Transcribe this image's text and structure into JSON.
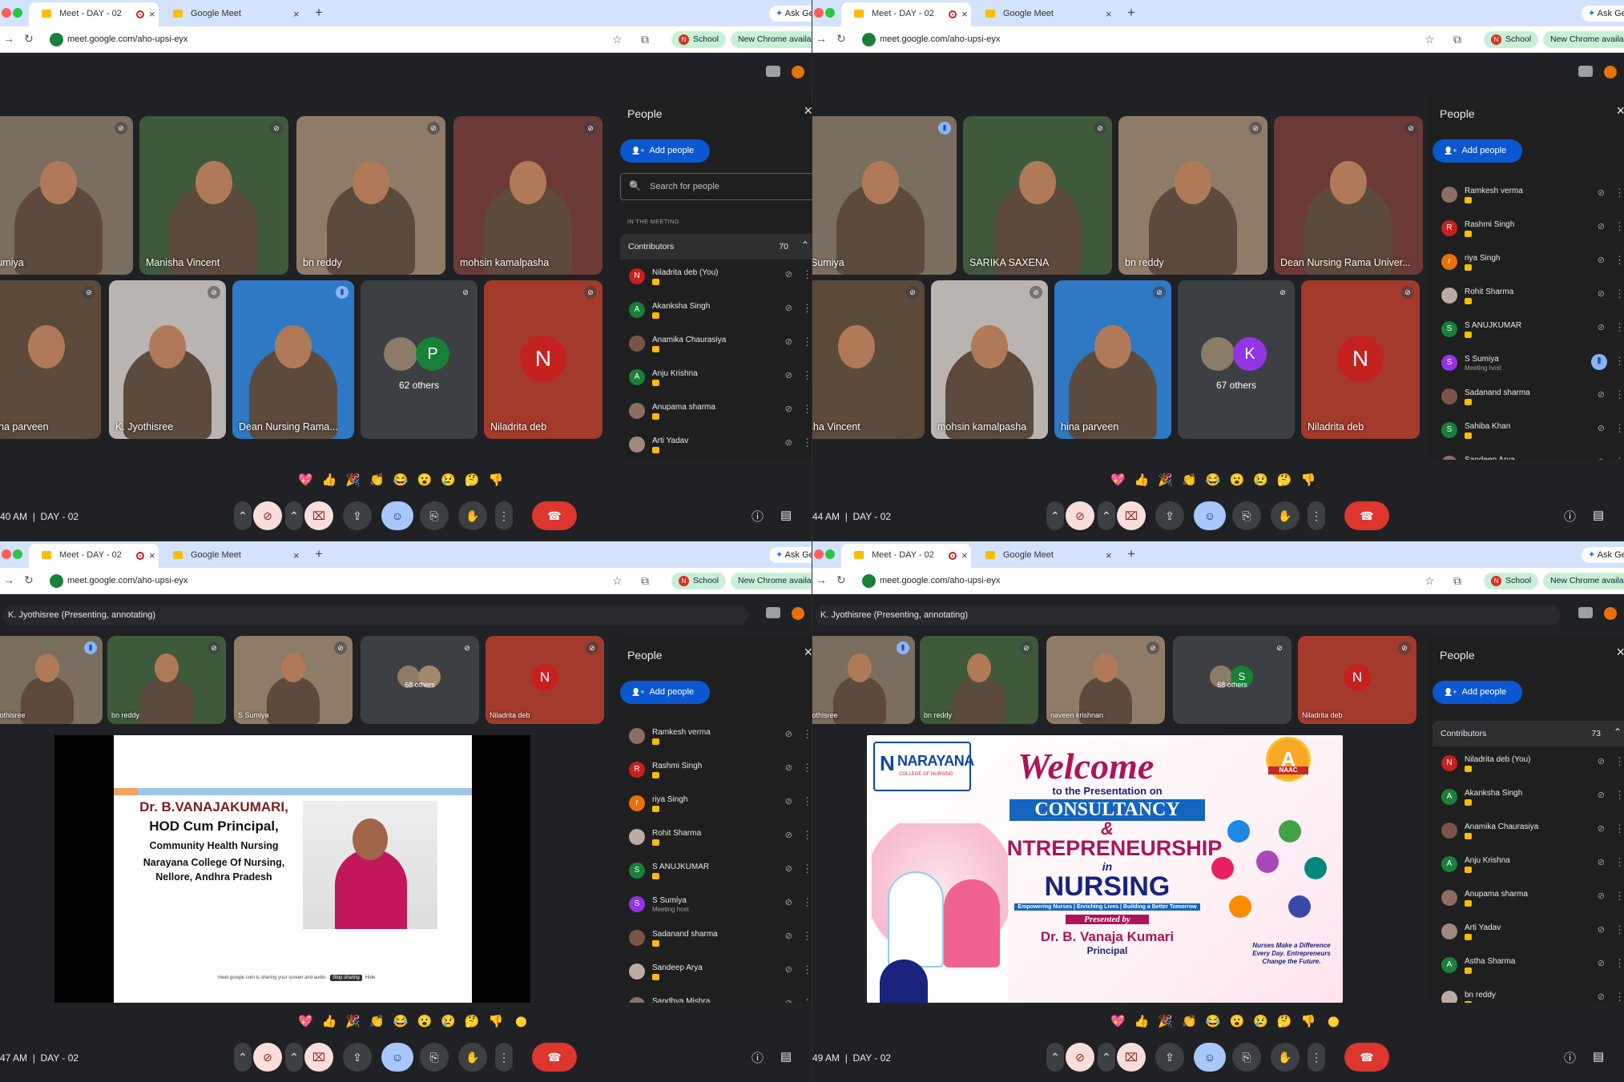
{
  "browser": {
    "tabs": [
      {
        "title": "Meet - DAY - 02"
      },
      {
        "title": "Google Meet"
      }
    ],
    "url": "meet.google.com/aho-upsi-eyx",
    "ask_label": "Ask Ge",
    "school_label": "School",
    "chrome_label": "New Chrome availab"
  },
  "meeting": {
    "day_label": "DAY - 02",
    "presenting_label": "K. Jyothisree (Presenting, annotating)"
  },
  "panels": [
    {
      "clock": "40 AM",
      "tiles": [
        {
          "name": "Sumiya"
        },
        {
          "name": "Manisha Vincent"
        },
        {
          "name": "bn reddy"
        },
        {
          "name": "mohsin kamalpasha"
        },
        {
          "name": "na parveen"
        },
        {
          "name": "K. Jyothisree"
        },
        {
          "name": "Dean Nursing Rama..."
        },
        {
          "name": "62 others",
          "letter": "P"
        },
        {
          "name": "Niladrita deb",
          "letter": "N"
        }
      ],
      "people": {
        "title": "People",
        "add": "Add people",
        "search": "Search for people",
        "in_meeting": "IN THE MEETING",
        "group": "Contributors",
        "count": "70",
        "list": [
          {
            "letter": "N",
            "name": "Niladrita deb (You)"
          },
          {
            "letter": "A",
            "name": "Akanksha Singh"
          },
          {
            "letter": "",
            "name": "Anamika Chaurasiya"
          },
          {
            "letter": "A",
            "name": "Anju Krishna"
          },
          {
            "letter": "",
            "name": "Anupama sharma"
          },
          {
            "letter": "",
            "name": "Arti Yadav"
          }
        ]
      }
    },
    {
      "clock": "44 AM",
      "tiles": [
        {
          "name": "Sumiya"
        },
        {
          "name": "SARIKA SAXENA"
        },
        {
          "name": "bn reddy"
        },
        {
          "name": "Dean Nursing Rama Univer..."
        },
        {
          "name": "anisha Vincent"
        },
        {
          "name": "mohsin kamalpasha"
        },
        {
          "name": "hina parveen"
        },
        {
          "name": "67 others",
          "letter": "K"
        },
        {
          "name": "Niladrita deb",
          "letter": "N"
        }
      ],
      "people": {
        "title": "People",
        "add": "Add people",
        "list": [
          {
            "letter": "",
            "name": "Ramkesh verma"
          },
          {
            "letter": "R",
            "name": "Rashmi Singh"
          },
          {
            "letter": "r",
            "name": "riya Singh"
          },
          {
            "letter": "",
            "name": "Rohit Sharma"
          },
          {
            "letter": "S",
            "name": "S ANUJKUMAR"
          },
          {
            "letter": "S",
            "name": "S Sumiya",
            "sub": "Meeting host"
          },
          {
            "letter": "",
            "name": "Sadanand sharma"
          },
          {
            "letter": "S",
            "name": "Sahiba Khan"
          },
          {
            "letter": "",
            "name": "Sandeep Arya"
          }
        ]
      }
    },
    {
      "clock": "47 AM",
      "tiles": [
        {
          "name": "yothisree"
        },
        {
          "name": "bn reddy"
        },
        {
          "name": "S Sumiya"
        },
        {
          "name": "68 others"
        },
        {
          "name": "Niladrita deb",
          "letter": "N"
        }
      ],
      "slide": {
        "lines": [
          "Dr. B.VANAJAKUMARI,",
          "HOD Cum Principal,",
          "Community Health Nursing",
          "Narayana College Of Nursing,",
          "Nellore, Andhra Pradesh"
        ],
        "share_text": "meet.google.com is sharing your screen and audio.",
        "stop_label": "Stop sharing",
        "hide_label": "Hide"
      },
      "people": {
        "title": "People",
        "add": "Add people",
        "list": [
          {
            "letter": "",
            "name": "Ramkesh verma"
          },
          {
            "letter": "R",
            "name": "Rashmi Singh"
          },
          {
            "letter": "r",
            "name": "riya Singh"
          },
          {
            "letter": "",
            "name": "Rohit Sharma"
          },
          {
            "letter": "S",
            "name": "S ANUJKUMAR"
          },
          {
            "letter": "S",
            "name": "S Sumiya",
            "sub": "Meeting host"
          },
          {
            "letter": "",
            "name": "Sadanand sharma"
          },
          {
            "letter": "",
            "name": "Sandeep Arya"
          },
          {
            "letter": "",
            "name": "Sandhya Mishra"
          }
        ]
      }
    },
    {
      "clock": "49 AM",
      "tiles": [
        {
          "name": "yothisree"
        },
        {
          "name": "bn reddy"
        },
        {
          "name": "naveen krishnan"
        },
        {
          "name": "68 others",
          "letter": "S"
        },
        {
          "name": "Niladrita deb",
          "letter": "N"
        }
      ],
      "slide": {
        "logo": "NARAYANA",
        "logo_sub": "COLLEGE OF NURSING",
        "welcome": "Welcome",
        "to_the": "to the Presentation on",
        "consultancy": "CONSULTANCY",
        "amp": "&",
        "entre": "ENTREPRENEURSHIP",
        "in": "in",
        "nursing": "NURSING",
        "tagline": "Empowering Nurses | Enriching Lives | Building a Better Tomorrow",
        "presented_by": "Presented by",
        "presenter": "Dr. B. Vanaja Kumari",
        "role": "Principal",
        "quote": "Nurses Make a Difference Every Day. Entrepreneurs Change the Future.",
        "badge": "A",
        "badge_sub": "NAAC"
      },
      "people": {
        "title": "People",
        "add": "Add people",
        "group": "Contributors",
        "count": "73",
        "list": [
          {
            "letter": "N",
            "name": "Niladrita deb (You)"
          },
          {
            "letter": "A",
            "name": "Akanksha Singh"
          },
          {
            "letter": "",
            "name": "Anamika Chaurasiya"
          },
          {
            "letter": "A",
            "name": "Anju Krishna"
          },
          {
            "letter": "",
            "name": "Anupama sharma"
          },
          {
            "letter": "",
            "name": "Arti Yadav"
          },
          {
            "letter": "A",
            "name": "Astha Sharma"
          },
          {
            "letter": "",
            "name": "bn reddy"
          }
        ]
      }
    }
  ],
  "colors": {
    "red": "#c5221f",
    "green": "#188038",
    "orange": "#e8710a",
    "purple": "#9334e6"
  }
}
